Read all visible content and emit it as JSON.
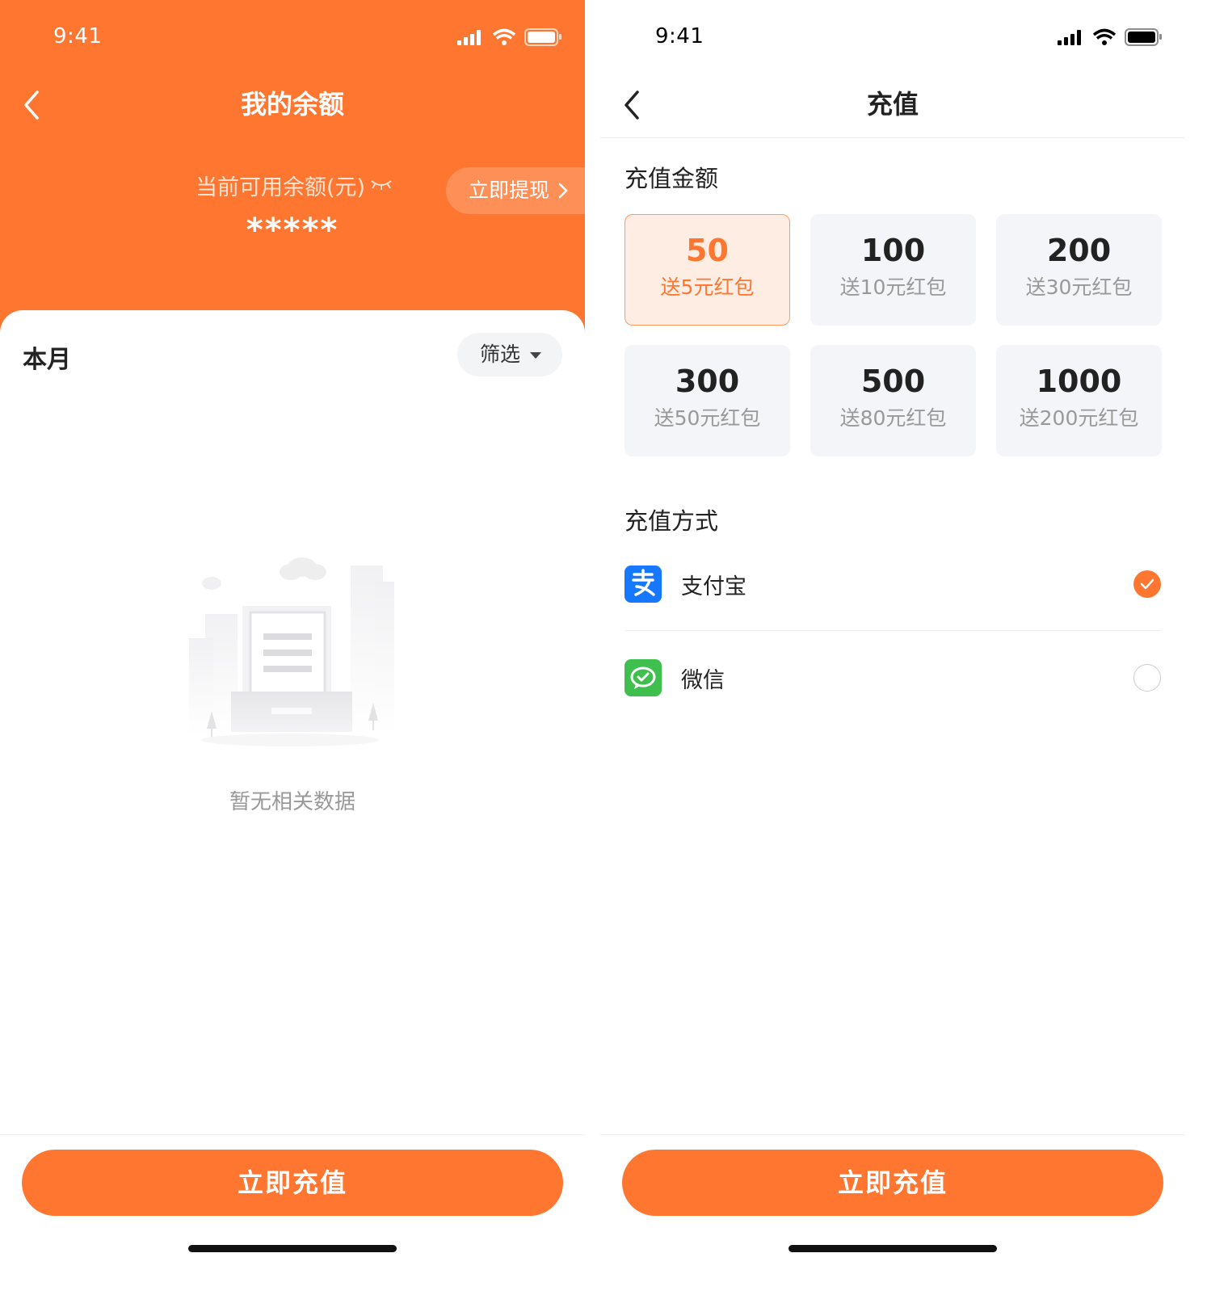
{
  "left_screen": {
    "status_time": "9:41",
    "title": "我的余额",
    "balance_label": "当前可用余额(元)",
    "balance_value": "*****",
    "withdraw_label": "立即提现",
    "month_label": "本月",
    "filter_label": "筛选",
    "empty_text": "暂无相关数据",
    "recharge_button": "立即充值"
  },
  "right_screen": {
    "status_time": "9:41",
    "title": "充值",
    "amount_section_title": "充值金额",
    "amounts": [
      {
        "amount": "50",
        "gift": "送5元红包",
        "selected": true
      },
      {
        "amount": "100",
        "gift": "送10元红包",
        "selected": false
      },
      {
        "amount": "200",
        "gift": "送30元红包",
        "selected": false
      },
      {
        "amount": "300",
        "gift": "送50元红包",
        "selected": false
      },
      {
        "amount": "500",
        "gift": "送80元红包",
        "selected": false
      },
      {
        "amount": "1000",
        "gift": "送200元红包",
        "selected": false
      }
    ],
    "method_section_title": "充值方式",
    "methods": [
      {
        "name": "支付宝",
        "icon": "alipay-icon",
        "checked": true
      },
      {
        "name": "微信",
        "icon": "wechat-icon",
        "checked": false
      }
    ],
    "recharge_button": "立即充值"
  },
  "colors": {
    "accent": "#FE7630",
    "selected_bg": "#FEEDE3",
    "card_bg": "#F4F5F8",
    "alipay": "#1677FF",
    "wechat": "#3FBF4E"
  }
}
